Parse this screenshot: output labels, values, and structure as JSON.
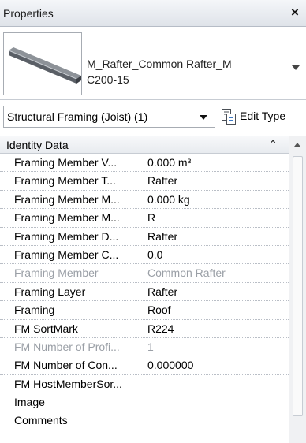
{
  "palette": {
    "title_bg": "#e6e9ee",
    "border": "#a7acb3",
    "dim_text": "#9a9fa6"
  },
  "window": {
    "title": "Properties",
    "close_label": "×"
  },
  "type_selector": {
    "line1": "M_Rafter_Common Rafter_M",
    "line2": "C200-15",
    "thumbnail_icon": "steel-beam-icon",
    "dropdown_icon": "chevron-down-icon"
  },
  "filter": {
    "selected": "Structural Framing (Joist) (1)",
    "dropdown_icon": "chevron-down-icon"
  },
  "edit_type": {
    "label": "Edit Type",
    "icon": "edit-type-icon"
  },
  "group": {
    "label": "Identity Data",
    "collapse_icon": "double-chevron-up-icon"
  },
  "rows": [
    {
      "name": "Framing Member V...",
      "value": "0.000 m³"
    },
    {
      "name": "Framing Member T...",
      "value": "Rafter"
    },
    {
      "name": "Framing Member M...",
      "value": "0.000 kg"
    },
    {
      "name": "Framing Member M...",
      "value": "R"
    },
    {
      "name": "Framing Member D...",
      "value": "Rafter"
    },
    {
      "name": "Framing Member C...",
      "value": "0.0"
    },
    {
      "name": "Framing Member",
      "value": "Common Rafter"
    },
    {
      "name": "Framing Layer",
      "value": "Rafter"
    },
    {
      "name": "Framing",
      "value": "Roof"
    },
    {
      "name": "FM SortMark",
      "value": "R224"
    },
    {
      "name": "FM Number of Profi...",
      "value": "1"
    },
    {
      "name": "FM Number of Con...",
      "value": "0.000000"
    },
    {
      "name": "FM HostMemberSor...",
      "value": ""
    },
    {
      "name": "Image",
      "value": ""
    },
    {
      "name": "Comments",
      "value": ""
    }
  ]
}
